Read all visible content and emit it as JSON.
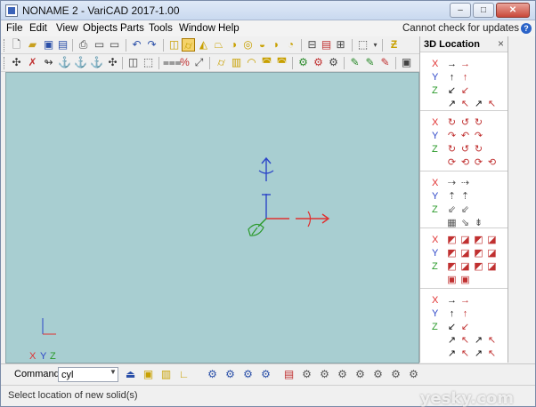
{
  "window": {
    "title": "NONAME 2 - VariCAD 2017-1.00",
    "controls": {
      "minimize": "–",
      "maximize": "□",
      "close": "✕"
    }
  },
  "menu": {
    "items": [
      "File",
      "Edit",
      "View",
      "Objects",
      "Parts",
      "Tools",
      "Window",
      "Help"
    ],
    "update_text": "Cannot check for updates",
    "help_glyph": "?"
  },
  "toolbar1": {
    "icons": [
      "new-file-icon",
      "open-folder-icon",
      "save-icon",
      "save-all-icon",
      "print-icon",
      "print-preview-icon",
      "export-icon",
      "undo-icon",
      "redo-icon",
      "box-icon",
      "cylinder-icon",
      "cone-icon",
      "truncated-cone-icon",
      "sphere-icon",
      "torus-icon",
      "pipe-bend-icon",
      "profile-icon",
      "elbow-icon",
      "extrude-icon",
      "revolve-icon",
      "section-2d-icon",
      "view-3d-icon",
      "settings-icon",
      "zoom-icon"
    ]
  },
  "toolbar2": {
    "icons": [
      "rotate-view-icon",
      "delete-icon",
      "move-icon",
      "copy-icon",
      "align-icon",
      "mirror-icon",
      "transform-icon",
      "solid-view-icon",
      "wireframe-icon",
      "measure-icon",
      "percent-icon",
      "dimension-icon",
      "fillet-icon",
      "chamfer-icon",
      "hole-icon",
      "shell-icon",
      "boolean-add-icon",
      "boolean-subtract-icon",
      "boolean-intersect-icon",
      "assembly-icon",
      "part-icon",
      "group-icon",
      "layer-icon",
      "render-icon"
    ]
  },
  "panel": {
    "title": "3D Location",
    "close": "×",
    "axes": [
      "X",
      "Y",
      "Z"
    ],
    "groups": [
      {
        "name": "move-along-axis",
        "rows": [
          [
            "→",
            "→"
          ],
          [
            "↑",
            "↑"
          ],
          [
            "↙",
            "↙"
          ],
          [
            "↗",
            "↖",
            "↗",
            "↖"
          ]
        ]
      },
      {
        "name": "rotate-around-axis",
        "rows": [
          [
            "↻",
            "↺",
            "↻"
          ],
          [
            "↷",
            "↶",
            "↷"
          ],
          [
            "↻",
            "↺",
            "↻"
          ],
          [
            "⟳",
            "⟲",
            "⟳",
            "⟲"
          ]
        ]
      },
      {
        "name": "move-by-value",
        "rows": [
          [
            "⇢",
            "⇢"
          ],
          [
            "⇡",
            "⇡"
          ],
          [
            "⇙",
            "⇙"
          ],
          [
            "▦",
            "⇘",
            "⇟"
          ]
        ]
      },
      {
        "name": "align-objects",
        "rows": [
          [
            "◩",
            "◪",
            "◩",
            "◪"
          ],
          [
            "◩",
            "◪",
            "◩",
            "◪"
          ],
          [
            "◩",
            "◪",
            "◩",
            "◪"
          ],
          [
            "▣",
            "▣"
          ]
        ]
      },
      {
        "name": "move-along-axis-2",
        "rows": [
          [
            "→",
            "→"
          ],
          [
            "↑",
            "↑"
          ],
          [
            "↙",
            "↙"
          ],
          [
            "↗",
            "↖",
            "↗",
            "↖"
          ],
          [
            "↗",
            "↖",
            "↗",
            "↖"
          ]
        ]
      }
    ]
  },
  "viewport": {
    "background": "#a8ced1",
    "corner_axis_labels": {
      "x": "X",
      "y": "Y",
      "z": "Z"
    },
    "colors": {
      "x": "#e03030",
      "y": "#2c45c8",
      "z": "#2a9a2a"
    }
  },
  "command": {
    "label": "Command:",
    "value": "cyl",
    "icons": [
      "command-run-icon",
      "box-small-icon",
      "cylinder-small-icon",
      "l-profile-icon",
      "snap-icon",
      "snap-grid-icon",
      "snap-point-icon",
      "snap-midpoint-icon",
      "snap-center-icon",
      "snap-edge-icon",
      "snap-face-icon",
      "snap-intersect-icon",
      "snap-tangent-icon",
      "snap-perpendicular-icon",
      "snap-nearest-icon",
      "snap-quadrant-icon"
    ]
  },
  "status": {
    "text": "Select location of new solid(s)"
  },
  "watermark": "yesky.com"
}
